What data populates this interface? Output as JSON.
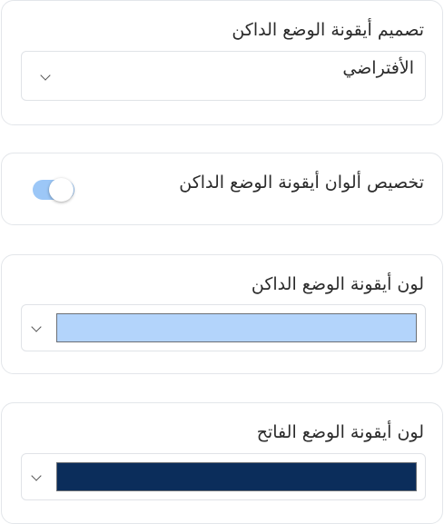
{
  "design_section": {
    "title": "تصميم أيقونة الوضع الداكن",
    "selected_value": "الأفتراضي",
    "chevron_icon": "chevron-down-icon"
  },
  "custom_colors_section": {
    "label": "تخصيص ألوان أيقونة الوضع الداكن",
    "toggle_on": true,
    "toggle_color": "#9cc7f7"
  },
  "dark_color_section": {
    "title": "لون أيقونة الوضع الداكن",
    "color": "#b3d4fb",
    "chevron_icon": "chevron-down-icon"
  },
  "light_color_section": {
    "title": "لون أيقونة الوضع الفاتح",
    "color": "#0b2d5b",
    "chevron_icon": "chevron-down-icon"
  }
}
